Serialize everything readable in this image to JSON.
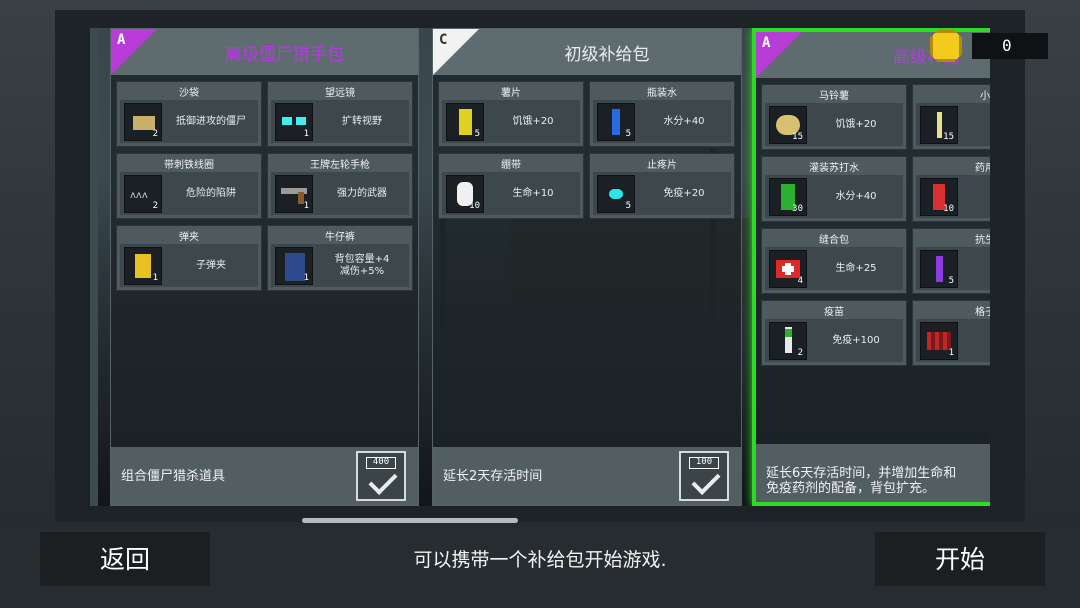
{
  "coins": {
    "count": "0"
  },
  "packs": [
    {
      "rank": "A",
      "title": "高级僵尸猎手包",
      "items": [
        {
          "name": "沙袋",
          "count": "2",
          "desc": "抵御进攻的僵尸",
          "icon": "sandbag-icon"
        },
        {
          "name": "望远镜",
          "count": "1",
          "desc": "扩转视野",
          "icon": "binoculars-icon"
        },
        {
          "name": "带刺铁线圈",
          "count": "2",
          "desc": "危险的陷阱",
          "icon": "barbed-wire-icon"
        },
        {
          "name": "王牌左轮手枪",
          "count": "1",
          "desc": "强力的武器",
          "icon": "revolver-icon"
        },
        {
          "name": "弹夹",
          "count": "1",
          "desc": "子弹夹",
          "icon": "ammo-clip-icon"
        },
        {
          "name": "牛仔裤",
          "count": "1",
          "desc": "背包容量+4\n减伤+5%",
          "icon": "jeans-icon"
        }
      ],
      "footer": "组合僵尸猎杀道具",
      "price": "400"
    },
    {
      "rank": "C",
      "title": "初级补给包",
      "items": [
        {
          "name": "薯片",
          "count": "5",
          "desc": "饥饿+20",
          "icon": "chips-icon"
        },
        {
          "name": "瓶装水",
          "count": "5",
          "desc": "水分+40",
          "icon": "water-bottle-icon"
        },
        {
          "name": "绷带",
          "count": "10",
          "desc": "生命+10",
          "icon": "bandage-icon"
        },
        {
          "name": "止疼片",
          "count": "5",
          "desc": "免疫+20",
          "icon": "painkiller-icon"
        }
      ],
      "footer": "延长2天存活时间",
      "price": "100"
    },
    {
      "rank": "A",
      "title": "高级补给",
      "items": [
        {
          "name": "马铃薯",
          "count": "15",
          "desc": "饥饿+20",
          "icon": "potato-icon"
        },
        {
          "name": "小",
          "count": "15",
          "desc": "饥",
          "icon": "wheat-icon"
        },
        {
          "name": "灌装苏打水",
          "count": "30",
          "desc": "水分+40",
          "icon": "soda-can-icon"
        },
        {
          "name": "药用",
          "count": "10",
          "desc": "生",
          "icon": "medicine-icon"
        },
        {
          "name": "缝合包",
          "count": "4",
          "desc": "生命+25",
          "icon": "first-aid-kit-icon"
        },
        {
          "name": "抗生",
          "count": "5",
          "desc": "免",
          "icon": "antibiotic-icon"
        },
        {
          "name": "疫苗",
          "count": "2",
          "desc": "免疫+100",
          "icon": "vaccine-icon"
        },
        {
          "name": "格子",
          "count": "1",
          "desc": "背\n减",
          "icon": "plaid-shirt-icon"
        }
      ],
      "footer": "延长6天存活时间，并增加生命和\n免疫药剂的配备，背包扩充。",
      "price": ""
    }
  ],
  "back_label": "返回",
  "start_label": "开始",
  "hint": "可以携带一个补给包开始游戏.",
  "colors": {
    "selected_border": "#2cdc24",
    "rank_a": "#b83cd6",
    "rank_c": "#f2f2f2",
    "title_a": "#b43ce0"
  }
}
